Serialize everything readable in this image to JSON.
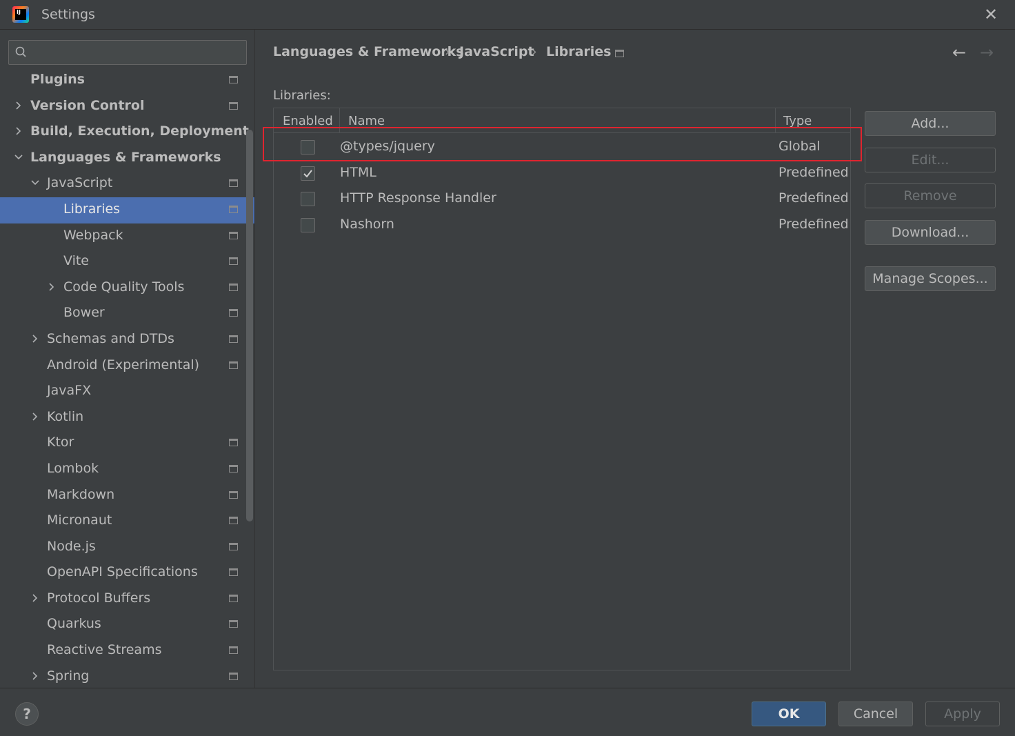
{
  "window": {
    "title": "Settings"
  },
  "search": {
    "placeholder": "",
    "value": ""
  },
  "sidebar": {
    "items": [
      {
        "label": "Plugins",
        "indent": 0,
        "bold": true,
        "arrow": "",
        "proj": true
      },
      {
        "label": "Version Control",
        "indent": 0,
        "bold": true,
        "arrow": "right",
        "proj": true
      },
      {
        "label": "Build, Execution, Deployment",
        "indent": 0,
        "bold": true,
        "arrow": "right",
        "proj": false
      },
      {
        "label": "Languages & Frameworks",
        "indent": 0,
        "bold": true,
        "arrow": "down",
        "proj": false
      },
      {
        "label": "JavaScript",
        "indent": 1,
        "bold": false,
        "arrow": "down",
        "proj": true
      },
      {
        "label": "Libraries",
        "indent": 2,
        "bold": false,
        "arrow": "",
        "proj": true,
        "selected": true
      },
      {
        "label": "Webpack",
        "indent": 2,
        "bold": false,
        "arrow": "",
        "proj": true
      },
      {
        "label": "Vite",
        "indent": 2,
        "bold": false,
        "arrow": "",
        "proj": true
      },
      {
        "label": "Code Quality Tools",
        "indent": 2,
        "bold": false,
        "arrow": "right",
        "proj": true
      },
      {
        "label": "Bower",
        "indent": 2,
        "bold": false,
        "arrow": "",
        "proj": true
      },
      {
        "label": "Schemas and DTDs",
        "indent": 1,
        "bold": false,
        "arrow": "right",
        "proj": true
      },
      {
        "label": "Android (Experimental)",
        "indent": 1,
        "bold": false,
        "arrow": "",
        "proj": true
      },
      {
        "label": "JavaFX",
        "indent": 1,
        "bold": false,
        "arrow": "",
        "proj": false
      },
      {
        "label": "Kotlin",
        "indent": 1,
        "bold": false,
        "arrow": "right",
        "proj": false
      },
      {
        "label": "Ktor",
        "indent": 1,
        "bold": false,
        "arrow": "",
        "proj": true
      },
      {
        "label": "Lombok",
        "indent": 1,
        "bold": false,
        "arrow": "",
        "proj": true
      },
      {
        "label": "Markdown",
        "indent": 1,
        "bold": false,
        "arrow": "",
        "proj": true
      },
      {
        "label": "Micronaut",
        "indent": 1,
        "bold": false,
        "arrow": "",
        "proj": true
      },
      {
        "label": "Node.js",
        "indent": 1,
        "bold": false,
        "arrow": "",
        "proj": true
      },
      {
        "label": "OpenAPI Specifications",
        "indent": 1,
        "bold": false,
        "arrow": "",
        "proj": true
      },
      {
        "label": "Protocol Buffers",
        "indent": 1,
        "bold": false,
        "arrow": "right",
        "proj": true
      },
      {
        "label": "Quarkus",
        "indent": 1,
        "bold": false,
        "arrow": "",
        "proj": true
      },
      {
        "label": "Reactive Streams",
        "indent": 1,
        "bold": false,
        "arrow": "",
        "proj": true
      },
      {
        "label": "Spring",
        "indent": 1,
        "bold": false,
        "arrow": "right",
        "proj": true
      }
    ]
  },
  "breadcrumb": {
    "items": [
      "Languages & Frameworks",
      "JavaScript",
      "Libraries"
    ],
    "separator": "›"
  },
  "nav": {
    "back": "←",
    "forward": "→"
  },
  "libraries": {
    "label": "Libraries:",
    "columns": [
      "Enabled",
      "Name",
      "Type"
    ],
    "rows": [
      {
        "enabled": false,
        "name": "@types/jquery",
        "type": "Global"
      },
      {
        "enabled": true,
        "name": "HTML",
        "type": "Predefined"
      },
      {
        "enabled": false,
        "name": "HTTP Response Handler",
        "type": "Predefined"
      },
      {
        "enabled": false,
        "name": "Nashorn",
        "type": "Predefined"
      }
    ]
  },
  "actions": {
    "add": "Add...",
    "edit": "Edit...",
    "remove": "Remove",
    "download": "Download...",
    "manage_scopes": "Manage Scopes..."
  },
  "footer": {
    "help": "?",
    "ok": "OK",
    "cancel": "Cancel",
    "apply": "Apply"
  },
  "colors": {
    "selection": "#4b6eaf",
    "highlight": "#e0242f",
    "primary": "#365880"
  }
}
